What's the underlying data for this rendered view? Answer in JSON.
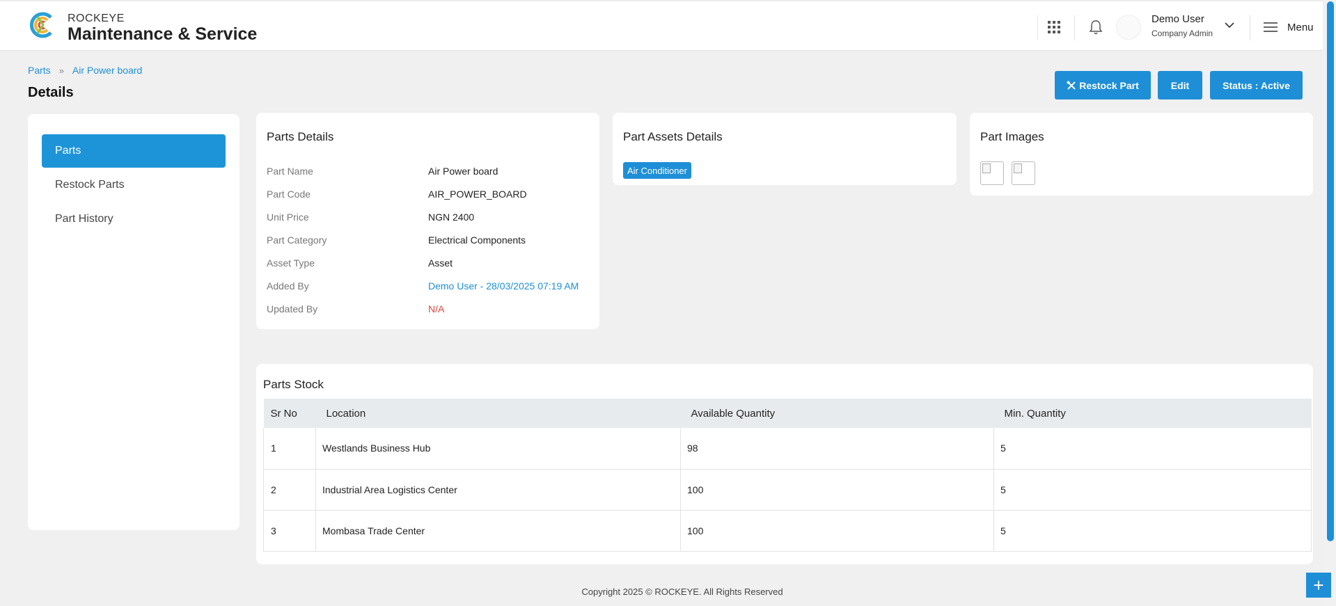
{
  "header": {
    "brand_small": "ROCKEYE",
    "brand_big": "Maintenance & Service",
    "user_name": "Demo User",
    "user_role": "Company Admin",
    "menu_label": "Menu"
  },
  "breadcrumb": {
    "items": [
      "Parts",
      "Air Power board"
    ]
  },
  "page_title": "Details",
  "actions": {
    "restock_label": "Restock Part",
    "edit_label": "Edit",
    "status_label": "Status : Active"
  },
  "sidebar": {
    "items": [
      {
        "label": "Parts",
        "active": true
      },
      {
        "label": "Restock Parts",
        "active": false
      },
      {
        "label": "Part History",
        "active": false
      }
    ]
  },
  "parts_details": {
    "title": "Parts Details",
    "rows": [
      {
        "key": "Part Name",
        "value": "Air Power board"
      },
      {
        "key": "Part Code",
        "value": "AIR_POWER_BOARD"
      },
      {
        "key": "Unit Price",
        "value": "NGN 2400"
      },
      {
        "key": "Part Category",
        "value": "Electrical Components"
      },
      {
        "key": "Asset Type",
        "value": "Asset"
      },
      {
        "key": "Added By",
        "value": "Demo User - 28/03/2025 07:19 AM"
      },
      {
        "key": "Updated By",
        "value": "N/A"
      }
    ]
  },
  "assets": {
    "title": "Part Assets Details",
    "tags": [
      "Air Conditioner"
    ]
  },
  "images": {
    "title": "Part Images"
  },
  "stock": {
    "title": "Parts Stock",
    "columns": [
      "Sr No",
      "Location",
      "Available Quantity",
      "Min. Quantity"
    ],
    "rows": [
      [
        "1",
        "Westlands Business Hub",
        "98",
        "5"
      ],
      [
        "2",
        "Industrial Area Logistics Center",
        "100",
        "5"
      ],
      [
        "3",
        "Mombasa Trade Center",
        "100",
        "5"
      ]
    ]
  },
  "footer": "Copyright 2025 © ROCKEYE. All Rights Reserved",
  "colors": {
    "accent": "#1e8fd6",
    "error": "#e0463e",
    "background": "#f0f0f0"
  }
}
